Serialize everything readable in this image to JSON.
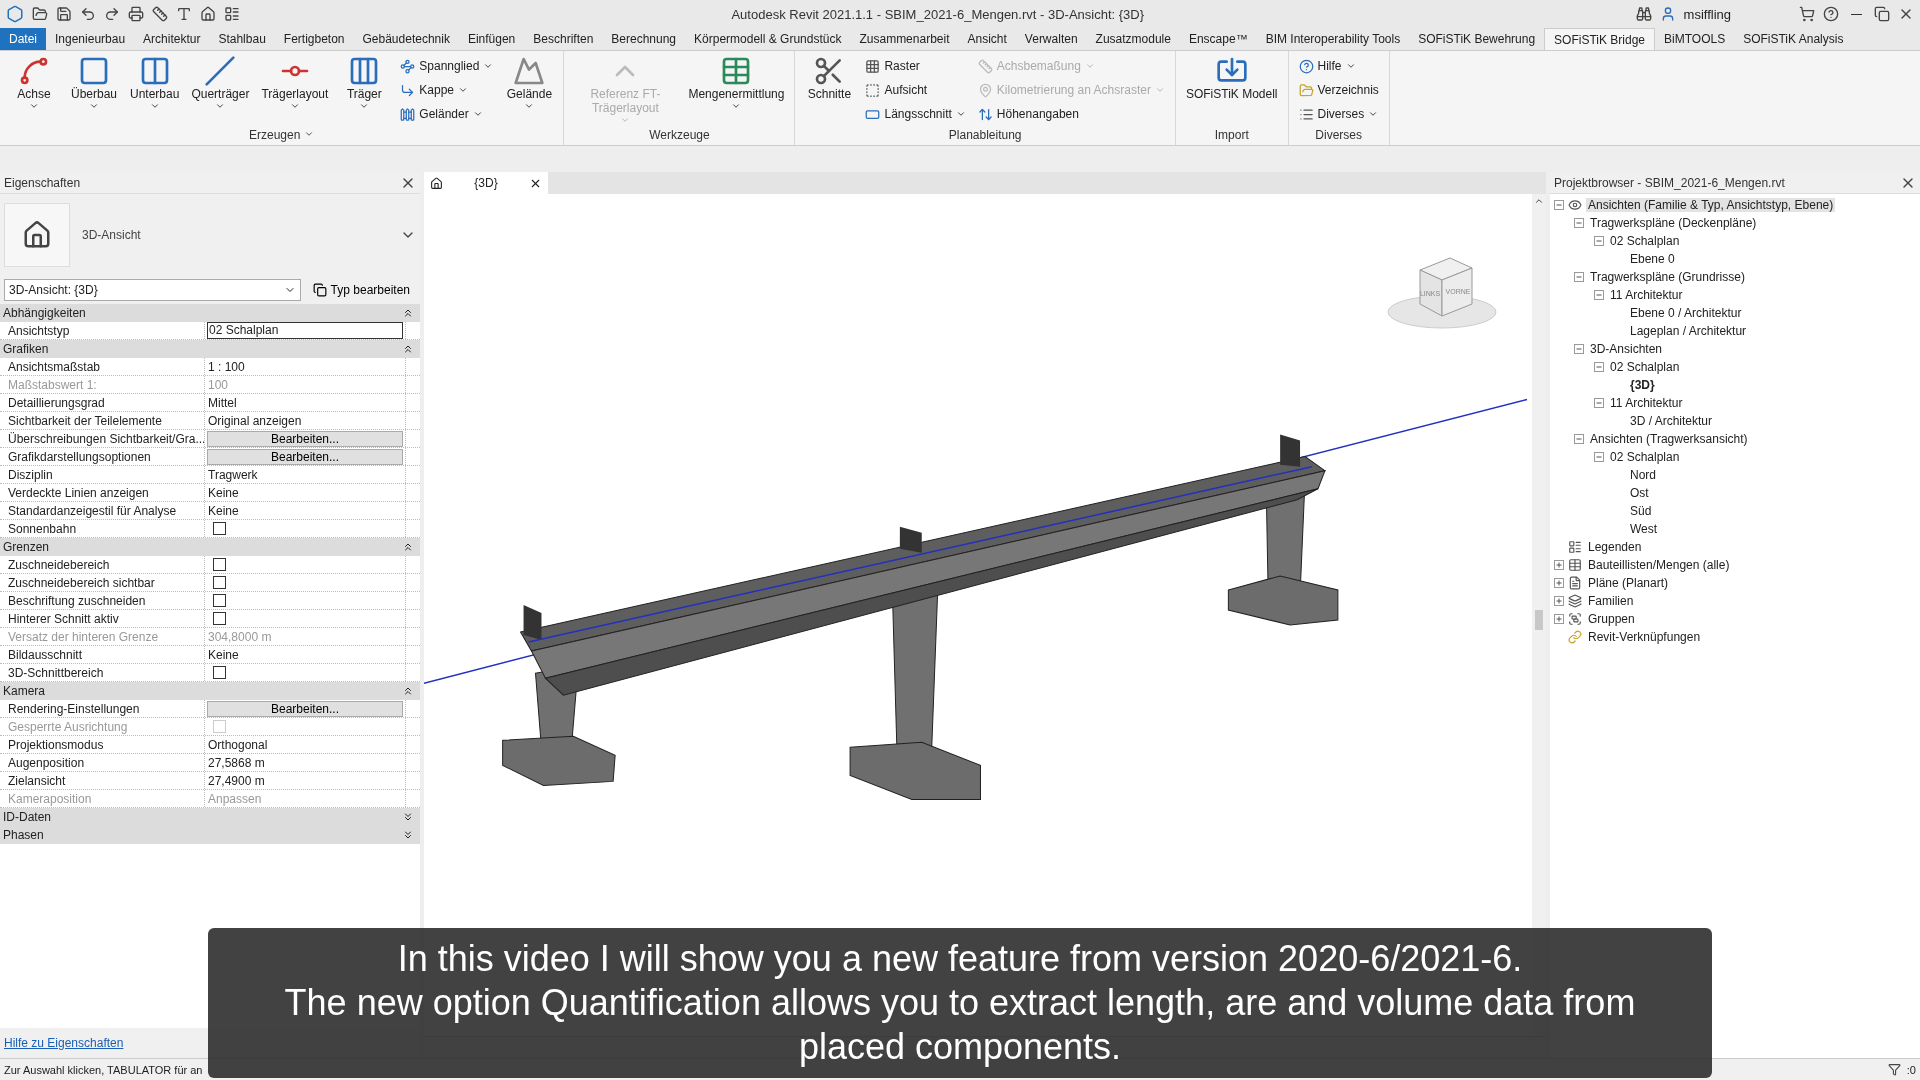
{
  "title_bar": {
    "title": "Autodesk Revit 2021.1.1 - SBIM_2021-6_Mengen.rvt - 3D-Ansicht: {3D}",
    "user": "msiffling"
  },
  "ribbon_tabs": [
    {
      "label": "Datei",
      "kind": "file",
      "selected": false
    },
    {
      "label": "Ingenieurbau",
      "kind": "tab",
      "selected": false
    },
    {
      "label": "Architektur",
      "kind": "tab",
      "selected": false
    },
    {
      "label": "Stahlbau",
      "kind": "tab",
      "selected": false
    },
    {
      "label": "Fertigbeton",
      "kind": "tab",
      "selected": false
    },
    {
      "label": "Gebäudetechnik",
      "kind": "tab",
      "selected": false
    },
    {
      "label": "Einfügen",
      "kind": "tab",
      "selected": false
    },
    {
      "label": "Beschriften",
      "kind": "tab",
      "selected": false
    },
    {
      "label": "Berechnung",
      "kind": "tab",
      "selected": false
    },
    {
      "label": "Körpermodell & Grundstück",
      "kind": "tab",
      "selected": false
    },
    {
      "label": "Zusammenarbeit",
      "kind": "tab",
      "selected": false
    },
    {
      "label": "Ansicht",
      "kind": "tab",
      "selected": false
    },
    {
      "label": "Verwalten",
      "kind": "tab",
      "selected": false
    },
    {
      "label": "Zusatzmodule",
      "kind": "tab",
      "selected": false
    },
    {
      "label": "Enscape™",
      "kind": "tab",
      "selected": false
    },
    {
      "label": "BIM Interoperability Tools",
      "kind": "tab",
      "selected": false
    },
    {
      "label": "SOFiSTiK Bewehrung",
      "kind": "tab",
      "selected": false
    },
    {
      "label": "SOFiSTiK Bridge",
      "kind": "tab",
      "selected": true
    },
    {
      "label": "BiMTOOLS",
      "kind": "tab",
      "selected": false
    },
    {
      "label": "SOFiSTiK Analysis",
      "kind": "tab",
      "selected": false
    }
  ],
  "ribbon_groups": [
    {
      "label": "Erzeugen",
      "menu": true,
      "tools": [
        {
          "label": "Achse",
          "kind": "large",
          "dropdown": true
        },
        {
          "label": "Überbau",
          "kind": "large",
          "dropdown": true
        },
        {
          "label": "Unterbau",
          "kind": "large",
          "dropdown": true
        },
        {
          "label": "Querträger",
          "kind": "large",
          "dropdown": true
        },
        {
          "label": "Trägerlayout",
          "kind": "large",
          "dropdown": true
        },
        {
          "label": "Träger",
          "kind": "large",
          "dropdown": true
        },
        {
          "label": "Spannglied",
          "kind": "small",
          "dropdown": true
        },
        {
          "label": "Kappe",
          "kind": "small",
          "dropdown": true
        },
        {
          "label": "Geländer",
          "kind": "small",
          "dropdown": true
        },
        {
          "label": "Gelände",
          "kind": "large",
          "dropdown": true
        }
      ]
    },
    {
      "label": "Werkzeuge",
      "menu": false,
      "tools": [
        {
          "label": "Referenz FT-Trägerlayout",
          "kind": "large",
          "dropdown": true,
          "disabled": true
        },
        {
          "label": "Mengenermittlung",
          "kind": "large",
          "dropdown": true
        }
      ]
    },
    {
      "label": "Planableitung",
      "menu": false,
      "tools": [
        {
          "label": "Schnitte",
          "kind": "large",
          "dropdown": false
        },
        {
          "label": "Raster",
          "kind": "small",
          "dropdown": false
        },
        {
          "label": "Aufsicht",
          "kind": "small",
          "dropdown": false
        },
        {
          "label": "Längsschnitt",
          "kind": "small",
          "dropdown": true
        },
        {
          "label": "Achsbemaßung",
          "kind": "small",
          "dropdown": true,
          "disabled": true
        },
        {
          "label": "Kilometrierung an Achsraster",
          "kind": "small",
          "dropdown": true,
          "disabled": true
        },
        {
          "label": "Höhenangaben",
          "kind": "small",
          "dropdown": false
        }
      ]
    },
    {
      "label": "Import",
      "menu": false,
      "tools": [
        {
          "label": "SOFiSTiK Modell",
          "kind": "large",
          "dropdown": false
        }
      ]
    },
    {
      "label": "Diverses",
      "menu": false,
      "tools": [
        {
          "label": "Hilfe",
          "kind": "small",
          "dropdown": true
        },
        {
          "label": "Verzeichnis",
          "kind": "small",
          "dropdown": false
        },
        {
          "label": "Diverses",
          "kind": "small",
          "dropdown": true
        }
      ]
    }
  ],
  "properties": {
    "title": "Eigenschaften",
    "type_name": "3D-Ansicht",
    "instance_selector": "3D-Ansicht: {3D}",
    "edit_type_button": "Typ bearbeiten",
    "sections": [
      {
        "name": "Abhängigkeiten",
        "expanded": true,
        "rows": [
          {
            "label": "Ansichtstyp",
            "kind": "field",
            "value": "02 Schalplan"
          }
        ]
      },
      {
        "name": "Grafiken",
        "expanded": true,
        "rows": [
          {
            "label": "Ansichtsmaßstab",
            "kind": "text",
            "value": "1 : 100"
          },
          {
            "label": "Maßstabswert 1:",
            "kind": "text",
            "value": "100",
            "disabled": true
          },
          {
            "label": "Detaillierungsgrad",
            "kind": "text",
            "value": "Mittel"
          },
          {
            "label": "Sichtbarkeit der Teilelemente",
            "kind": "text",
            "value": "Original anzeigen"
          },
          {
            "label": "Überschreibungen Sichtbarkeit/Gra...",
            "kind": "button",
            "value": "Bearbeiten..."
          },
          {
            "label": "Grafikdarstellungsoptionen",
            "kind": "button",
            "value": "Bearbeiten..."
          },
          {
            "label": "Disziplin",
            "kind": "text",
            "value": "Tragwerk"
          },
          {
            "label": "Verdeckte Linien anzeigen",
            "kind": "text",
            "value": "Keine"
          },
          {
            "label": "Standardanzeigestil für Analyse",
            "kind": "text",
            "value": "Keine"
          },
          {
            "label": "Sonnenbahn",
            "kind": "checkbox",
            "checked": false
          }
        ]
      },
      {
        "name": "Grenzen",
        "expanded": true,
        "rows": [
          {
            "label": "Zuschneidebereich",
            "kind": "checkbox",
            "checked": false
          },
          {
            "label": "Zuschneidebereich sichtbar",
            "kind": "checkbox",
            "checked": false
          },
          {
            "label": "Beschriftung zuschneiden",
            "kind": "checkbox",
            "checked": false
          },
          {
            "label": "Hinterer Schnitt aktiv",
            "kind": "checkbox",
            "checked": false
          },
          {
            "label": "Versatz der hinteren Grenze",
            "kind": "text",
            "value": "304,8000 m",
            "disabled": true
          },
          {
            "label": "Bildausschnitt",
            "kind": "text",
            "value": "Keine"
          },
          {
            "label": "3D-Schnittbereich",
            "kind": "checkbox",
            "checked": false
          }
        ]
      },
      {
        "name": "Kamera",
        "expanded": true,
        "rows": [
          {
            "label": "Rendering-Einstellungen",
            "kind": "button",
            "value": "Bearbeiten..."
          },
          {
            "label": "Gesperrte Ausrichtung",
            "kind": "checkbox",
            "checked": false,
            "disabled": true
          },
          {
            "label": "Projektionsmodus",
            "kind": "text",
            "value": "Orthogonal"
          },
          {
            "label": "Augenposition",
            "kind": "text",
            "value": "27,5868 m"
          },
          {
            "label": "Zielansicht",
            "kind": "text",
            "value": "27,4900 m"
          },
          {
            "label": "Kameraposition",
            "kind": "text",
            "value": "Anpassen",
            "disabled": true
          }
        ]
      },
      {
        "name": "ID-Daten",
        "expanded": false
      },
      {
        "name": "Phasen",
        "expanded": false
      }
    ],
    "help_link": "Hilfe zu Eigenschaften"
  },
  "view_tab": {
    "label": "{3D}"
  },
  "view_cube": {
    "faces": [
      "LINKS",
      "VORNE"
    ]
  },
  "browser": {
    "title": "Projektbrowser - SBIM_2021-6_Mengen.rvt",
    "tree": [
      {
        "label": "Ansichten (Familie & Typ, Ansichtstyp, Ebene)",
        "selected": true,
        "expanded": true,
        "children": [
          {
            "label": "Tragwerkspläne (Deckenpläne)",
            "selected": false,
            "expanded": true,
            "children": [
              {
                "label": "02 Schalplan",
                "selected": false,
                "expanded": true,
                "children": [
                  {
                    "label": "Ebene 0",
                    "selected": false
                  }
                ]
              }
            ]
          },
          {
            "label": "Tragwerkspläne (Grundrisse)",
            "selected": false,
            "expanded": true,
            "children": [
              {
                "label": "11 Architektur",
                "selected": false,
                "expanded": true,
                "children": [
                  {
                    "label": "Ebene 0 / Architektur",
                    "selected": false
                  },
                  {
                    "label": "Lageplan  / Architektur",
                    "selected": false
                  }
                ]
              }
            ]
          },
          {
            "label": "3D-Ansichten",
            "selected": false,
            "expanded": true,
            "children": [
              {
                "label": "02 Schalplan",
                "selected": false,
                "expanded": true,
                "children": [
                  {
                    "label": "{3D}",
                    "selected": false,
                    "current": true
                  }
                ]
              },
              {
                "label": "11 Architektur",
                "selected": false,
                "expanded": true,
                "children": [
                  {
                    "label": "3D / Architektur",
                    "selected": false
                  }
                ]
              }
            ]
          },
          {
            "label": "Ansichten (Tragwerksansicht)",
            "selected": false,
            "expanded": true,
            "children": [
              {
                "label": "02 Schalplan",
                "selected": false,
                "expanded": true,
                "children": [
                  {
                    "label": "Nord",
                    "selected": false
                  },
                  {
                    "label": "Ost",
                    "selected": false
                  },
                  {
                    "label": "Süd",
                    "selected": false
                  },
                  {
                    "label": "West",
                    "selected": false
                  }
                ]
              }
            ]
          }
        ]
      },
      {
        "label": "Legenden",
        "selected": false
      },
      {
        "label": "Bauteillisten/Mengen (alle)",
        "selected": false,
        "expanded": false
      },
      {
        "label": "Pläne (Planart)",
        "selected": false,
        "expanded": false
      },
      {
        "label": "Familien",
        "selected": false,
        "expanded": false
      },
      {
        "label": "Gruppen",
        "selected": false,
        "expanded": false
      },
      {
        "label": "Revit-Verknüpfungen",
        "selected": false
      }
    ]
  },
  "status_bar": {
    "text": "Zur Auswahl klicken, TABULATOR für an",
    "filter": ":0"
  },
  "caption": {
    "lines": [
      "In this video I will show you a new feature from version 2020-6/2021-6.",
      "The new option Quantification allows you to extract length, are and volume data from",
      "placed components."
    ]
  }
}
